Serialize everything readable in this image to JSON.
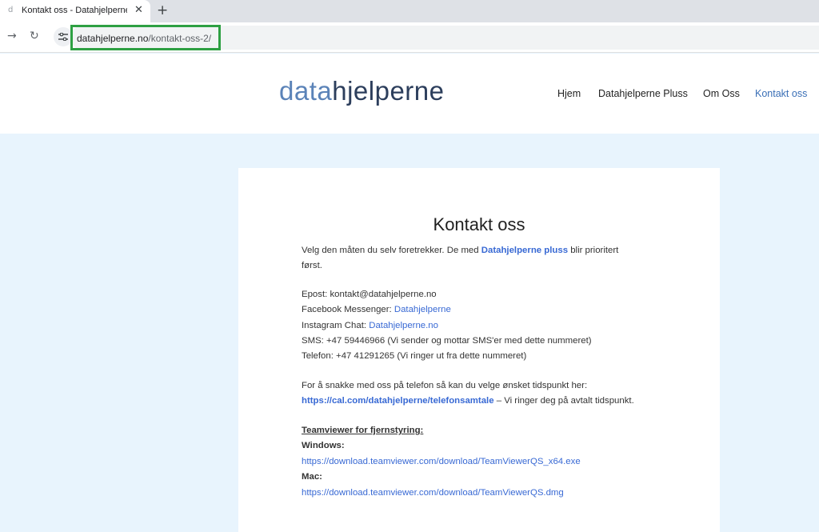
{
  "browser": {
    "tab_title": "Kontakt oss - Datahjelperne.no",
    "tab_favicon": "d",
    "tab_close_icon": "close-icon",
    "new_tab_icon": "plus-icon",
    "url_domain": "datahjelperne.no",
    "url_path": "/kontakt-oss-2/",
    "highlight_color": "#2ea043"
  },
  "site": {
    "logo_light": "data",
    "logo_bold": "hjelperne",
    "nav": [
      "Hjem",
      "Datahjelperne Pluss",
      "Om Oss",
      "Kontakt oss"
    ],
    "active_nav": "Kontakt oss",
    "accent_color": "#3a6fb6",
    "background_color": "#e8f4fd"
  },
  "content": {
    "title": "Kontakt oss",
    "intro_1": "Velg den måten du selv foretrekker. De med",
    "intro_link": "Datahjelperne pluss",
    "intro_2": "blir prioritert",
    "intro_3": "først.",
    "epost": "Epost: kontakt@datahjelperne.no",
    "facebook_label": "Facebook Messenger:",
    "facebook_link": "Datahjelperne",
    "instagram_label": "Instagram Chat:",
    "instagram_link": "Datahjelperne.no",
    "sms": "SMS: +47 59446966 (Vi sender og mottar SMS'er med dette nummeret)",
    "telefon": "Telefon: +47 41291265 (Vi ringer ut fra dette nummeret)",
    "phone_intro": "For å snakke med oss på telefon så kan du velge ønsket tidspunkt her:",
    "cal_link": "https://cal.com/datahjelperne/telefonsamtale",
    "cal_suffix": "– Vi ringer deg på avtalt tidspunkt.",
    "teamviewer_heading": "Teamviewer for fjernstyring:",
    "windows_label": "Windows:",
    "windows_link": "https://download.teamviewer.com/download/TeamViewerQS_x64.exe",
    "mac_label": "Mac:",
    "mac_link": "https://download.teamviewer.com/download/TeamViewerQS.dmg"
  }
}
